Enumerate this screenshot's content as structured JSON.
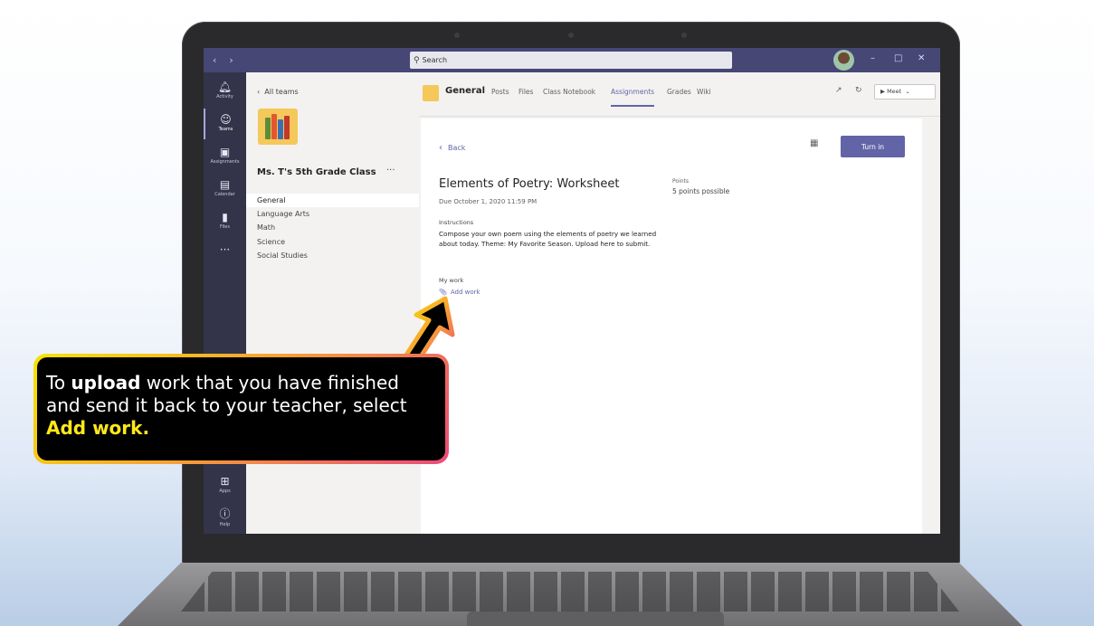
{
  "titlebar": {
    "back_arrow": "‹",
    "forward_arrow": "›",
    "search_placeholder": "Search",
    "minimize": "–",
    "maximize": "□",
    "close": "✕"
  },
  "rail": {
    "items": [
      {
        "label": "Activity",
        "icon": "bell-icon"
      },
      {
        "label": "Teams",
        "icon": "teams-icon"
      },
      {
        "label": "Assignments",
        "icon": "assignments-icon"
      },
      {
        "label": "Calendar",
        "icon": "calendar-icon"
      },
      {
        "label": "Files",
        "icon": "files-icon"
      },
      {
        "label": "",
        "icon": "more-icon"
      },
      {
        "label": "Apps",
        "icon": "apps-icon"
      },
      {
        "label": "Help",
        "icon": "help-icon"
      }
    ]
  },
  "channels": {
    "back_label": "All teams",
    "team_name": "Ms. T's 5th Grade Class",
    "more": "···",
    "items": [
      "General",
      "Language Arts",
      "Math",
      "Science",
      "Social Studies"
    ]
  },
  "header": {
    "channel_title": "General",
    "tabs": [
      "Posts",
      "Files",
      "Class Notebook",
      "Assignments",
      "Grades",
      "Wiki"
    ],
    "active_tab": "Assignments",
    "meet_label": "Meet"
  },
  "assignment": {
    "back_label": "Back",
    "turn_in_label": "Turn in",
    "title": "Elements of Poetry: Worksheet",
    "due": "Due October 1, 2020 11:59 PM",
    "points_label": "Points",
    "points_value": "5 points possible",
    "instructions_label": "Instructions",
    "instructions_text": "Compose your own poem using the elements of poetry we learned about today. Theme: My Favorite Season. Upload here to submit.",
    "my_work_label": "My work",
    "add_work_label": "Add work"
  },
  "callout": {
    "part1": "To ",
    "bold1": "upload",
    "part2": " work that you have finished and send it back to your teacher, select ",
    "bold2": "Add work."
  },
  "colors": {
    "titlebar": "#464775",
    "rail": "#33344a",
    "accent": "#6264a7",
    "callout_highlight": "#ffe81a"
  }
}
